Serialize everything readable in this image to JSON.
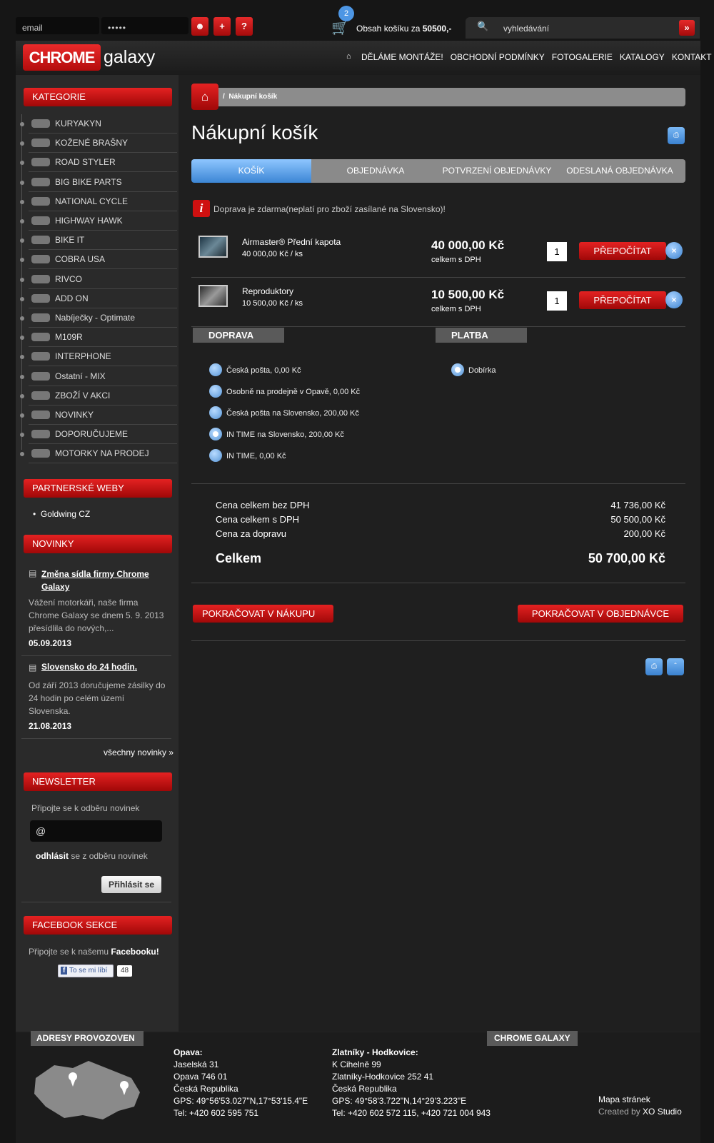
{
  "topbar": {
    "email_placeholder": "email",
    "password_value": "•••••",
    "cart_count": "2",
    "cart_label": "Obsah košíku za",
    "cart_total": "50500,-",
    "search_placeholder": "vyhledávání",
    "search_go": "»"
  },
  "logo": {
    "brand": "CHROME",
    "sub": "galaxy"
  },
  "nav": [
    "DĚLÁME MONTÁŽE!",
    "OBCHODNÍ PODMÍNKY",
    "FOTOGALERIE",
    "KATALOGY",
    "KONTAKT"
  ],
  "sidebar": {
    "categories_title": "KATEGORIE",
    "categories": [
      "KURYAKYN",
      "KOŽENÉ BRAŠNY",
      "ROAD STYLER",
      "BIG BIKE PARTS",
      "NATIONAL CYCLE",
      "HIGHWAY HAWK",
      "BIKE IT",
      "COBRA USA",
      "RIVCO",
      "ADD ON",
      "Nabíječky - Optimate",
      "M109R",
      "INTERPHONE",
      "Ostatní - MIX",
      "ZBOŽÍ V AKCI",
      "NOVINKY",
      "DOPORUČUJEME",
      "MOTORKY NA PRODEJ"
    ],
    "partners_title": "PARTNERSKÉ WEBY",
    "partners": [
      "Goldwing CZ"
    ],
    "news_title": "NOVINKY",
    "news": [
      {
        "title": "Změna sídla firmy Chrome Galaxy",
        "text": "Vážení motorkáři, naše firma Chrome Galaxy se dnem 5. 9. 2013 přesídlila do nových,...",
        "date": "05.09.2013"
      },
      {
        "title": "Slovensko do 24 hodin.",
        "text": "Od září 2013 doručujeme zásilky do 24 hodin po celém území Slovenska.",
        "date": "21.08.2013"
      }
    ],
    "all_news": "všechny novinky »",
    "newsletter_title": "NEWSLETTER",
    "newsletter_text": "Připojte se k odběru novinek",
    "newsletter_placeholder": "@",
    "unsub_bold": "odhlásit",
    "unsub_rest": " se z odběru novinek",
    "subscribe_btn": "Přihlásit se",
    "facebook_title": "FACEBOOK SEKCE",
    "facebook_text": "Připojte se k našemu",
    "facebook_link": "Facebooku!",
    "like_label": "To se mi líbí",
    "like_count": "48"
  },
  "breadcrumb": {
    "current": "Nákupní košík"
  },
  "page_title": "Nákupní košík",
  "tabs": [
    "KOŠÍK",
    "OBJEDNÁVKA",
    "POTVRZENÍ OBJEDNÁVKY",
    "ODESLANÁ OBJEDNÁVKA"
  ],
  "notice": "Doprava je zdarma(neplatí pro zboží zasílané na Slovensko)!",
  "items": [
    {
      "name": "Airmaster® Přední kapota",
      "unit_price": "40 000,00 Kč / ks",
      "total": "40 000,00 Kč",
      "total_note": "celkem s DPH",
      "qty": "1",
      "recalc": "PŘEPOČÍTAT"
    },
    {
      "name": "Reproduktory",
      "unit_price": "10 500,00 Kč / ks",
      "total": "10 500,00 Kč",
      "total_note": "celkem s DPH",
      "qty": "1",
      "recalc": "PŘEPOČÍTAT"
    }
  ],
  "shipping": {
    "title": "DOPRAVA",
    "options": [
      "Česká pošta, 0,00 Kč",
      "Osobně na prodejně v Opavě, 0,00 Kč",
      "Česká pošta na Slovensko, 200,00 Kč",
      "IN TIME na Slovensko, 200,00 Kč",
      "IN TIME, 0,00 Kč"
    ],
    "selected": 3
  },
  "payment": {
    "title": "PLATBA",
    "options": [
      "Dobírka"
    ]
  },
  "summary": {
    "rows": [
      {
        "label": "Cena celkem bez DPH",
        "value": "41 736,00 Kč"
      },
      {
        "label": "Cena celkem s DPH",
        "value": "50 500,00 Kč"
      },
      {
        "label": "Cena za dopravu",
        "value": "200,00 Kč"
      }
    ],
    "total_label": "Celkem",
    "total_value": "50 700,00 Kč"
  },
  "buttons": {
    "continue_shopping": "POKRAČOVAT V NÁKUPU",
    "continue_order": "POKRAČOVAT V OBJEDNÁVCE"
  },
  "footer": {
    "addresses_title": "ADRESY PROVOZOVEN",
    "brand_title": "CHROME GALAXY",
    "opava": [
      "Opava:",
      "Jaselská 31",
      "Opava 746 01",
      "Česká Republika",
      "GPS: 49°56'53.027\"N,17°53'15.4\"E",
      "Tel: +420 602 595 751"
    ],
    "zlatniky": [
      "Zlatníky - Hodkovice:",
      "K Cihelně 99",
      "Zlatníky-Hodkovice 252 41",
      "Česká Republika",
      "GPS: 49°58'3.722\"N,14°29'3.223\"E",
      "Tel: +420 602 572 115, +420 721 004 943"
    ],
    "sitemap": "Mapa stránek",
    "created_by": "Created by",
    "studio": "XO Studio"
  },
  "colors": {
    "accent_red": "#d61010",
    "accent_blue": "#4f96dc"
  }
}
